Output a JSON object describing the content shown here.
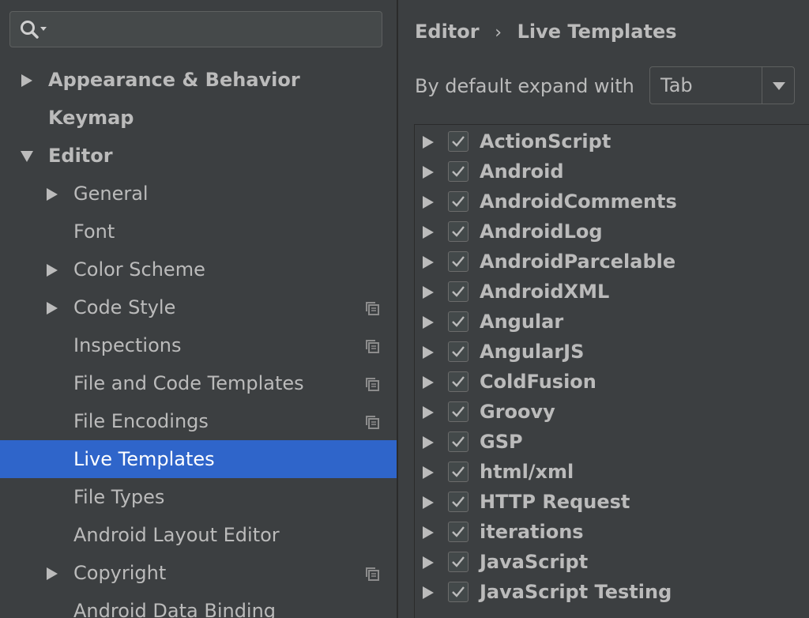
{
  "search": {
    "placeholder": "",
    "value": ""
  },
  "sidebar": {
    "items": [
      {
        "label": "Appearance & Behavior",
        "level": 0,
        "expandable": true,
        "expanded": false,
        "bold": true,
        "copy_icon": false,
        "selected": false
      },
      {
        "label": "Keymap",
        "level": 0,
        "expandable": false,
        "expanded": false,
        "bold": true,
        "copy_icon": false,
        "selected": false
      },
      {
        "label": "Editor",
        "level": 0,
        "expandable": true,
        "expanded": true,
        "bold": true,
        "copy_icon": false,
        "selected": false
      },
      {
        "label": "General",
        "level": 1,
        "expandable": true,
        "expanded": false,
        "bold": false,
        "copy_icon": false,
        "selected": false
      },
      {
        "label": "Font",
        "level": 1,
        "expandable": false,
        "expanded": false,
        "bold": false,
        "copy_icon": false,
        "selected": false
      },
      {
        "label": "Color Scheme",
        "level": 1,
        "expandable": true,
        "expanded": false,
        "bold": false,
        "copy_icon": false,
        "selected": false
      },
      {
        "label": "Code Style",
        "level": 1,
        "expandable": true,
        "expanded": false,
        "bold": false,
        "copy_icon": true,
        "selected": false
      },
      {
        "label": "Inspections",
        "level": 1,
        "expandable": false,
        "expanded": false,
        "bold": false,
        "copy_icon": true,
        "selected": false
      },
      {
        "label": "File and Code Templates",
        "level": 1,
        "expandable": false,
        "expanded": false,
        "bold": false,
        "copy_icon": true,
        "selected": false
      },
      {
        "label": "File Encodings",
        "level": 1,
        "expandable": false,
        "expanded": false,
        "bold": false,
        "copy_icon": true,
        "selected": false
      },
      {
        "label": "Live Templates",
        "level": 1,
        "expandable": false,
        "expanded": false,
        "bold": false,
        "copy_icon": false,
        "selected": true
      },
      {
        "label": "File Types",
        "level": 1,
        "expandable": false,
        "expanded": false,
        "bold": false,
        "copy_icon": false,
        "selected": false
      },
      {
        "label": "Android Layout Editor",
        "level": 1,
        "expandable": false,
        "expanded": false,
        "bold": false,
        "copy_icon": false,
        "selected": false
      },
      {
        "label": "Copyright",
        "level": 1,
        "expandable": true,
        "expanded": false,
        "bold": false,
        "copy_icon": true,
        "selected": false
      },
      {
        "label": "Android Data Binding",
        "level": 1,
        "expandable": false,
        "expanded": false,
        "bold": false,
        "copy_icon": false,
        "selected": false
      }
    ]
  },
  "header": {
    "breadcrumb_parent": "Editor",
    "breadcrumb_separator": "›",
    "breadcrumb_current": "Live Templates"
  },
  "expand": {
    "label": "By default expand with",
    "selected": "Tab",
    "options": [
      "Tab"
    ]
  },
  "templates": [
    {
      "label": "ActionScript",
      "checked": true
    },
    {
      "label": "Android",
      "checked": true
    },
    {
      "label": "AndroidComments",
      "checked": true
    },
    {
      "label": "AndroidLog",
      "checked": true
    },
    {
      "label": "AndroidParcelable",
      "checked": true
    },
    {
      "label": "AndroidXML",
      "checked": true
    },
    {
      "label": "Angular",
      "checked": true
    },
    {
      "label": "AngularJS",
      "checked": true
    },
    {
      "label": "ColdFusion",
      "checked": true
    },
    {
      "label": "Groovy",
      "checked": true
    },
    {
      "label": "GSP",
      "checked": true
    },
    {
      "label": "html/xml",
      "checked": true
    },
    {
      "label": "HTTP Request",
      "checked": true
    },
    {
      "label": "iterations",
      "checked": true
    },
    {
      "label": "JavaScript",
      "checked": true
    },
    {
      "label": "JavaScript Testing",
      "checked": true
    }
  ],
  "icons": {
    "search": "search-icon",
    "expand_arrow": "triangle-right-icon",
    "collapse_arrow": "triangle-down-icon",
    "copy": "copy-icon",
    "checkbox": "checkmark-icon",
    "dropdown": "chevron-down-icon"
  },
  "colors": {
    "background": "#3c3f41",
    "selection": "#2f65ca",
    "text": "#bbbbbb",
    "selected_text": "#ffffff",
    "border": "#5e6060"
  }
}
